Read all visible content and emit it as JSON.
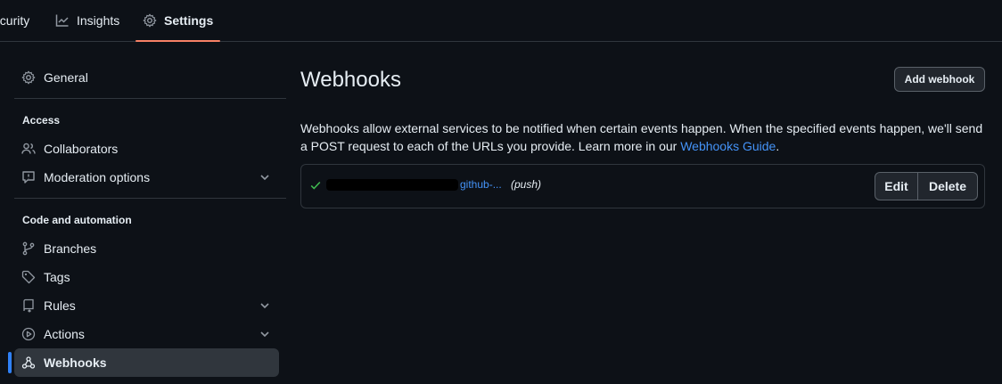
{
  "tabs": {
    "security": "ecurity",
    "insights": "Insights",
    "settings": "Settings"
  },
  "sidebar": {
    "general": "General",
    "access_heading": "Access",
    "collaborators": "Collaborators",
    "moderation": "Moderation options",
    "code_heading": "Code and automation",
    "branches": "Branches",
    "tags": "Tags",
    "rules": "Rules",
    "actions": "Actions",
    "webhooks": "Webhooks"
  },
  "main": {
    "title": "Webhooks",
    "add_button": "Add webhook",
    "description_line1": "Webhooks allow external services to be notified when certain events happen. When the specified events happen, we'll send",
    "description_line2": "a POST request to each of the URLs you provide. Learn more in our ",
    "guide_link": "Webhooks Guide",
    "description_end": ".",
    "webhook": {
      "url": "github-...",
      "events": "(push)",
      "edit": "Edit",
      "delete": "Delete"
    }
  },
  "colors": {
    "background": "#0d1117",
    "border": "#30363d",
    "link": "#4493f8",
    "success": "#3fb950",
    "tab_underline": "#f78166",
    "active_indicator": "#2f81f7"
  }
}
